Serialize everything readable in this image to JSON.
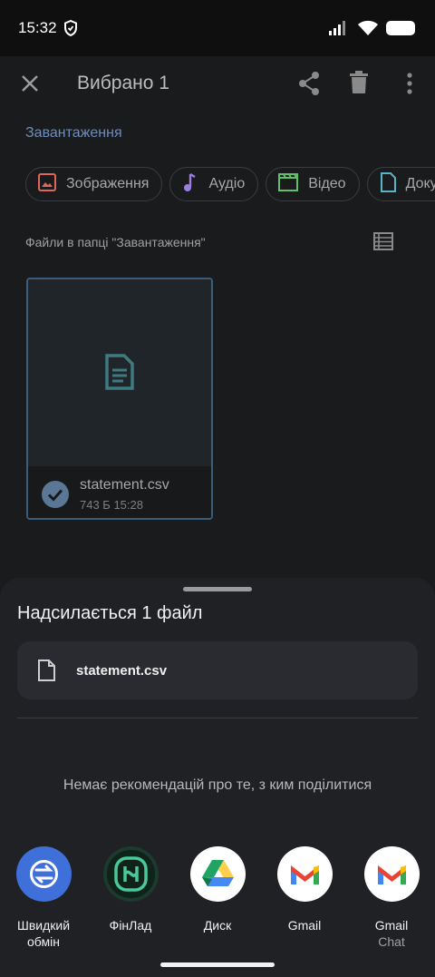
{
  "status_bar": {
    "time": "15:32"
  },
  "toolbar": {
    "title": "Вибрано 1"
  },
  "breadcrumb": {
    "folder": "Завантаження"
  },
  "filter_chips": [
    {
      "label": "Зображення",
      "icon": "image-icon",
      "color": "#e0665c"
    },
    {
      "label": "Аудіо",
      "icon": "music-note-icon",
      "color": "#9b7fe0"
    },
    {
      "label": "Відео",
      "icon": "clapperboard-icon",
      "color": "#5fbf6a"
    },
    {
      "label": "Документи",
      "icon": "document-icon",
      "color": "#5ab4c8"
    }
  ],
  "files_section": {
    "label": "Файли в папці \"Завантаження\""
  },
  "file_card": {
    "name": "statement.csv",
    "meta": "743 Б 15:28",
    "selected": true
  },
  "share_sheet": {
    "heading": "Надсилається 1 файл",
    "file_name": "statement.csv",
    "no_recommendations": "Немає рекомендацій про те, з ким поділитися",
    "apps": [
      {
        "line1": "Швидкий",
        "line2": "обмін",
        "sub": "",
        "icon": "quick-share-icon"
      },
      {
        "line1": "ФінЛад",
        "line2": "",
        "sub": "",
        "icon": "finlad-icon"
      },
      {
        "line1": "Диск",
        "line2": "",
        "sub": "",
        "icon": "google-drive-icon"
      },
      {
        "line1": "Gmail",
        "line2": "",
        "sub": "",
        "icon": "gmail-icon"
      },
      {
        "line1": "Gmail",
        "line2": "",
        "sub": "Chat",
        "icon": "gmail-icon"
      }
    ]
  },
  "colors": {
    "accent_link": "#6f8db8",
    "selection": "#5a7896",
    "sheet_bg": "#1f2125"
  }
}
